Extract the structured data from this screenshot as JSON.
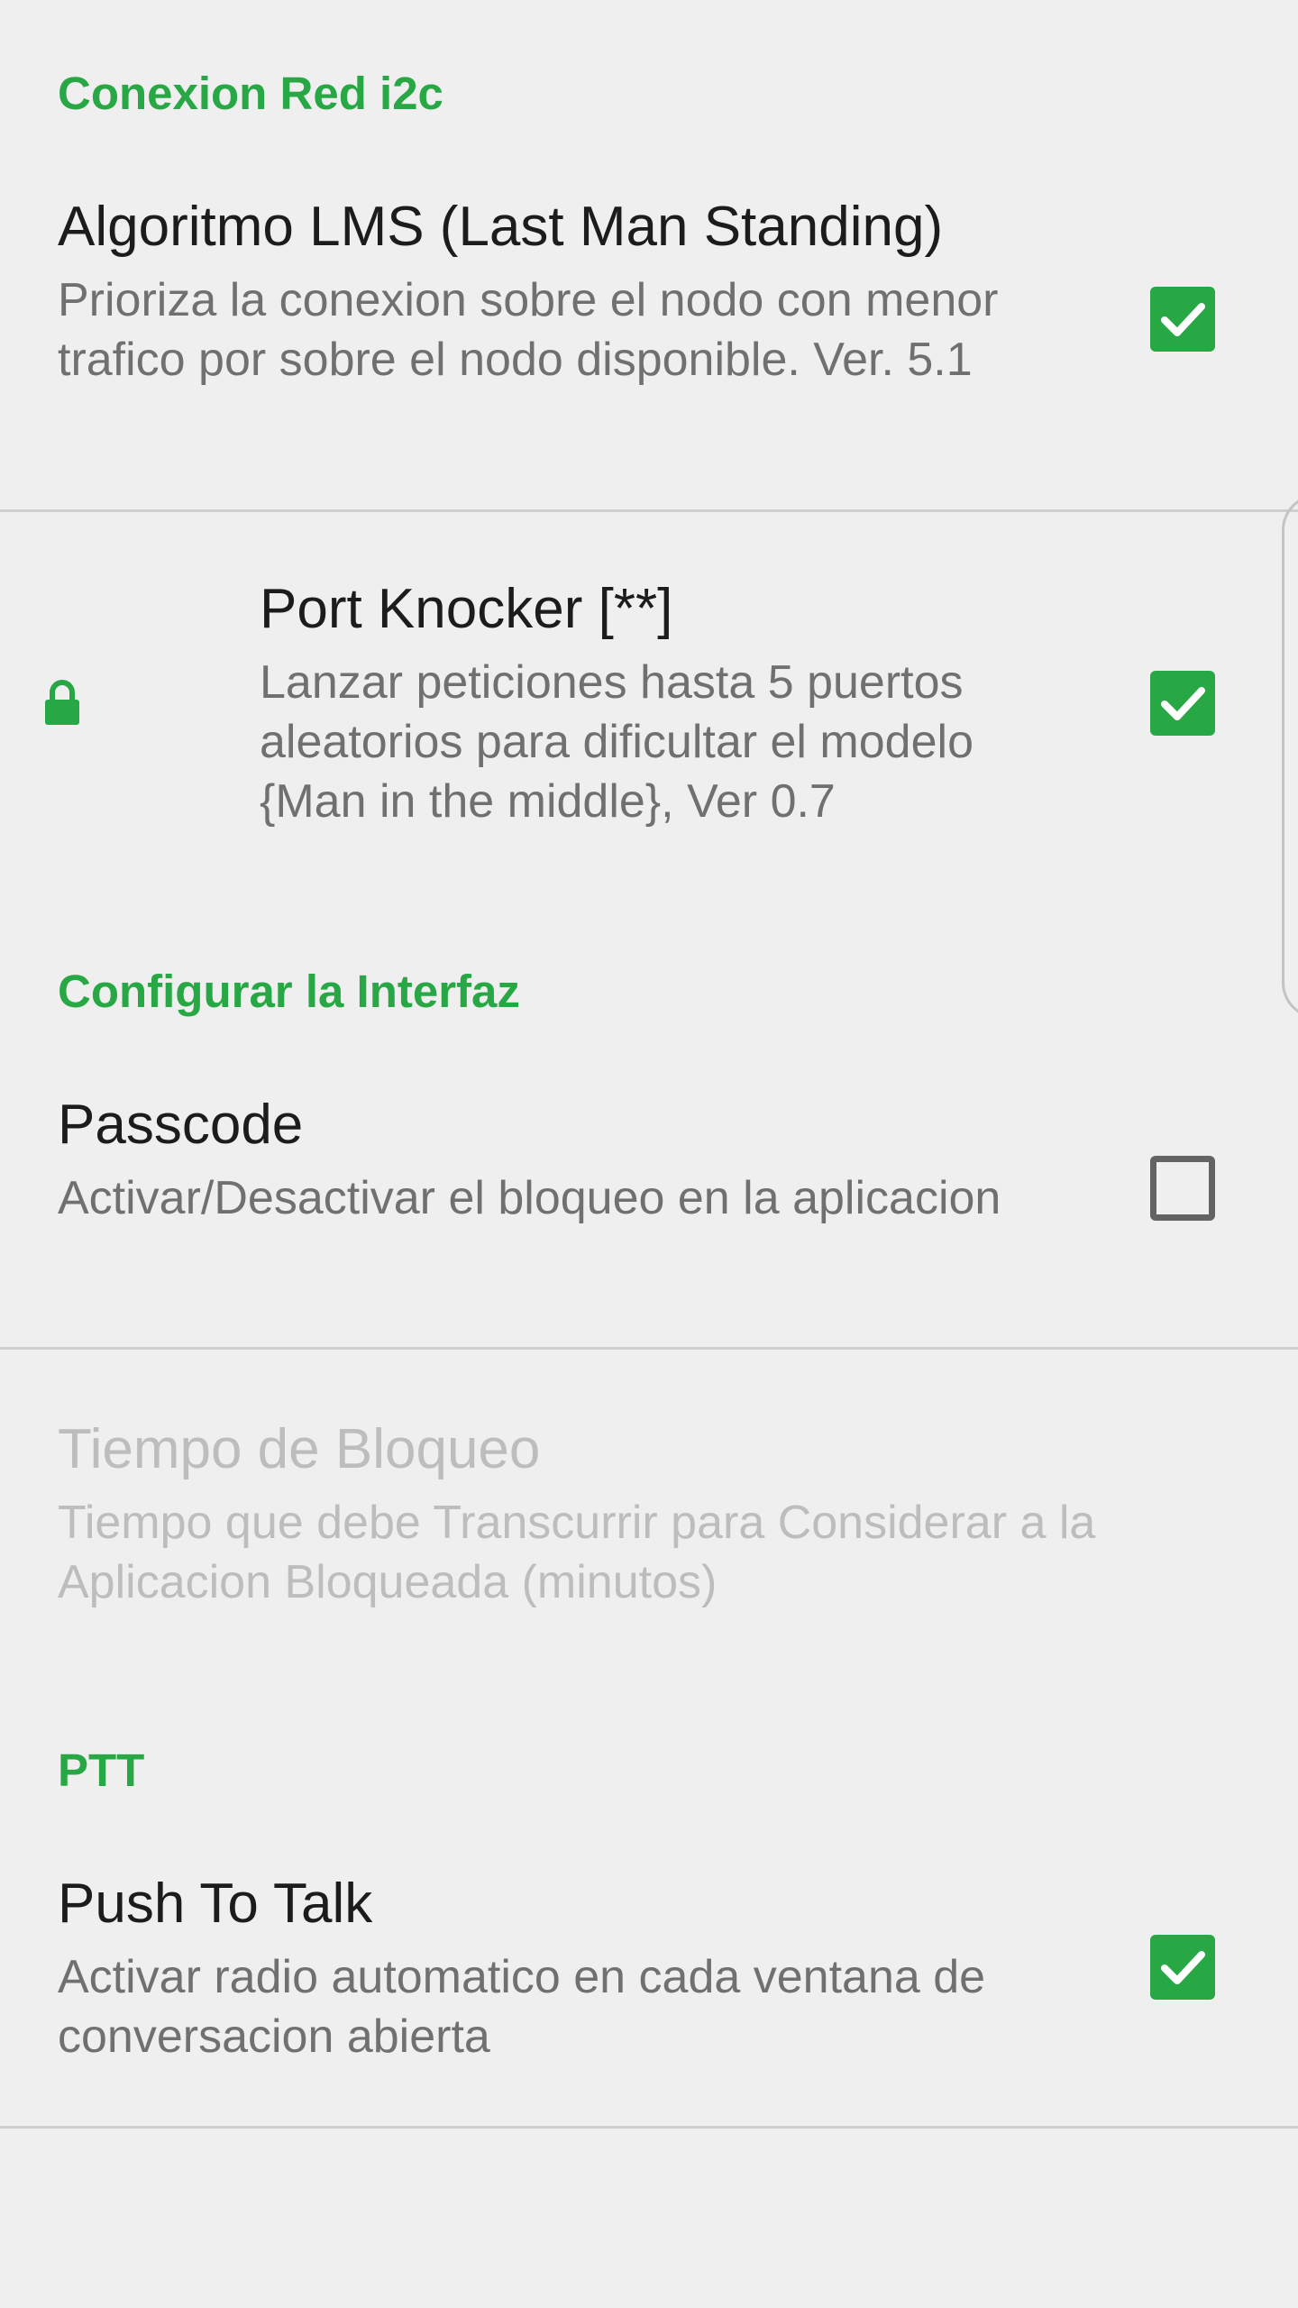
{
  "sections": {
    "network": {
      "header": "Conexion Red i2c"
    },
    "interface": {
      "header": "Configurar la Interfaz"
    },
    "ptt": {
      "header": "PTT"
    }
  },
  "prefs": {
    "lms": {
      "title": "Algoritmo LMS (Last Man Standing)",
      "summary": "Prioriza la conexion sobre el nodo con menor trafico por sobre el nodo disponible. Ver. 5.1",
      "checked": true
    },
    "port_knocker": {
      "title": "Port Knocker [**]",
      "summary": "Lanzar peticiones hasta 5 puertos aleatorios para dificultar el modelo {Man in the middle}, Ver 0.7",
      "checked": true,
      "icon": "lock-icon"
    },
    "passcode": {
      "title": "Passcode",
      "summary": "Activar/Desactivar el bloqueo en la aplicacion",
      "checked": false
    },
    "lock_time": {
      "title": "Tiempo de Bloqueo",
      "summary": "Tiempo que debe Transcurrir para Considerar a la Aplicacion Bloqueada (minutos)",
      "enabled": false
    },
    "push_to_talk": {
      "title": "Push To Talk",
      "summary": "Activar radio automatico en cada ventana de conversacion abierta",
      "checked": true
    }
  },
  "colors": {
    "accent": "#28a745",
    "background": "#efefef",
    "title_text": "#1c1c1c",
    "summary_text": "#707070",
    "disabled_text": "#bdbdbd",
    "divider": "#cfcfcf"
  }
}
